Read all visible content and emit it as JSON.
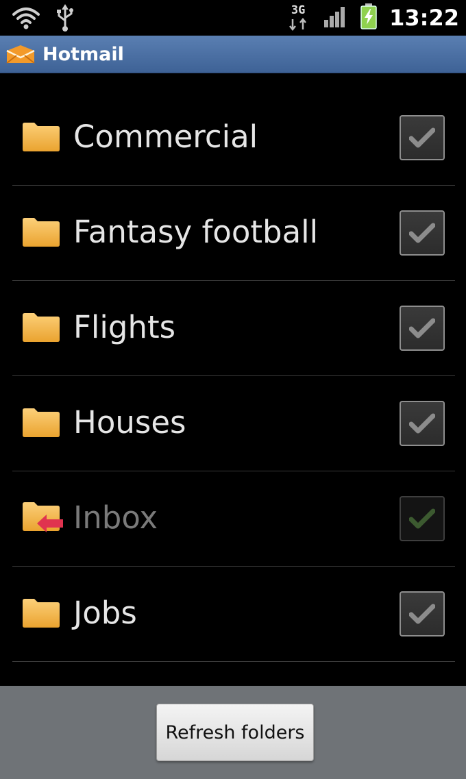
{
  "status_bar": {
    "network_type": "3G",
    "time": "13:22",
    "icons": [
      "wifi-icon",
      "usb-icon",
      "data-transfer-icon",
      "signal-icon",
      "battery-charging-icon"
    ]
  },
  "app": {
    "title": "Hotmail",
    "logo_icon": "hotmail-envelope-icon",
    "accent_color": "#4a6fa5"
  },
  "folders": [
    {
      "name": "Commercial",
      "checked": true,
      "enabled": true,
      "icon": "folder-icon"
    },
    {
      "name": "Fantasy football",
      "checked": true,
      "enabled": true,
      "icon": "folder-icon"
    },
    {
      "name": "Flights",
      "checked": true,
      "enabled": true,
      "icon": "folder-icon"
    },
    {
      "name": "Houses",
      "checked": true,
      "enabled": true,
      "icon": "folder-icon"
    },
    {
      "name": "Inbox",
      "checked": true,
      "enabled": false,
      "icon": "inbox-folder-icon"
    },
    {
      "name": "Jobs",
      "checked": true,
      "enabled": true,
      "icon": "folder-icon"
    }
  ],
  "footer": {
    "refresh_label": "Refresh folders"
  }
}
